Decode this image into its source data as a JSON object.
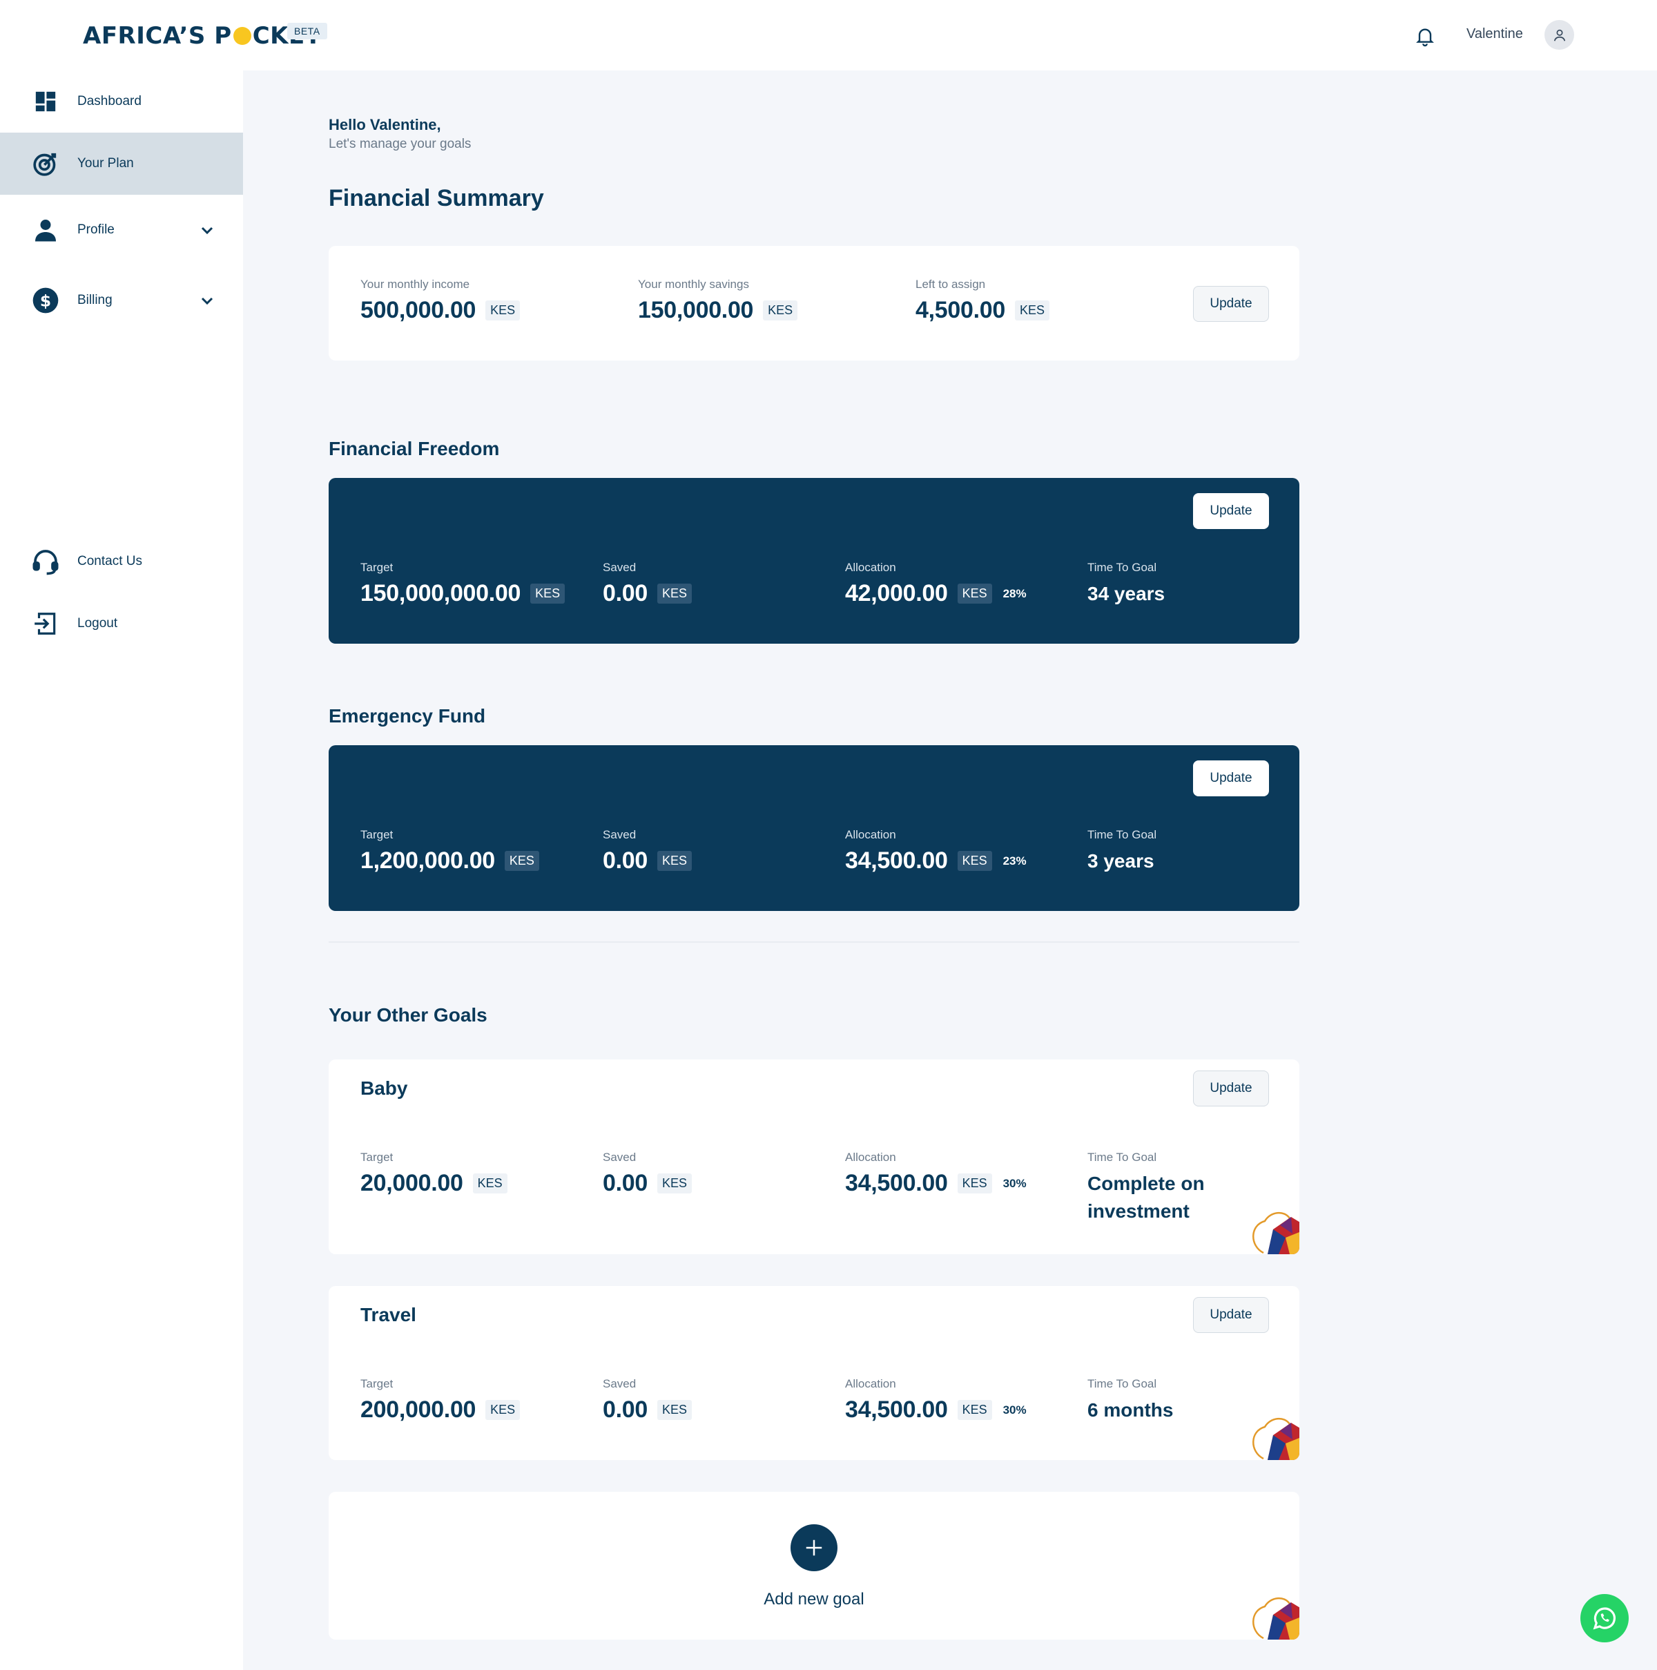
{
  "header": {
    "logo_text_left": "AFRICA’S P",
    "logo_text_right": "CKET",
    "beta": "BETA",
    "username": "Valentine"
  },
  "sidebar": {
    "items": [
      {
        "label": "Dashboard",
        "icon": "dashboard-icon"
      },
      {
        "label": "Your Plan",
        "icon": "target-icon",
        "active": true
      },
      {
        "label": "Profile",
        "icon": "user-icon"
      },
      {
        "label": "Billing",
        "icon": "dollar-icon"
      },
      {
        "label": "Contact Us",
        "icon": "headset-icon"
      },
      {
        "label": "Logout",
        "icon": "logout-icon"
      }
    ]
  },
  "greeting": {
    "hello": "Hello Valentine,",
    "sub": "Let's manage your goals"
  },
  "summary": {
    "title": "Financial Summary",
    "income_label": "Your monthly income",
    "income_value": "500,000.00",
    "savings_label": "Your monthly savings",
    "savings_value": "150,000.00",
    "left_label": "Left to assign",
    "left_value": "4,500.00",
    "currency": "KES",
    "update": "Update"
  },
  "labels": {
    "target": "Target",
    "saved": "Saved",
    "allocation": "Allocation",
    "time_to_goal": "Time To Goal",
    "currency": "KES",
    "update": "Update"
  },
  "freedom": {
    "title": "Financial Freedom",
    "target": "150,000,000.00",
    "saved": "0.00",
    "allocation": "42,000.00",
    "pct": "28%",
    "time": "34 years"
  },
  "emergency": {
    "title": "Emergency Fund",
    "target": "1,200,000.00",
    "saved": "0.00",
    "allocation": "34,500.00",
    "pct": "23%",
    "time": "3 years"
  },
  "other_goals": {
    "title": "Your Other Goals",
    "goals": [
      {
        "name": "Baby",
        "target": "20,000.00",
        "saved": "0.00",
        "allocation": "34,500.00",
        "pct": "30%",
        "time_line1": "Complete on",
        "time_line2": "investment"
      },
      {
        "name": "Travel",
        "target": "200,000.00",
        "saved": "0.00",
        "allocation": "34,500.00",
        "pct": "30%",
        "time_line1": "6 months",
        "time_line2": ""
      }
    ],
    "add_label": "Add new goal"
  },
  "colors": {
    "brand": "#0b3a5a",
    "accent": "#f8c620",
    "background": "#f4f6fa",
    "whatsapp": "#25d366"
  }
}
